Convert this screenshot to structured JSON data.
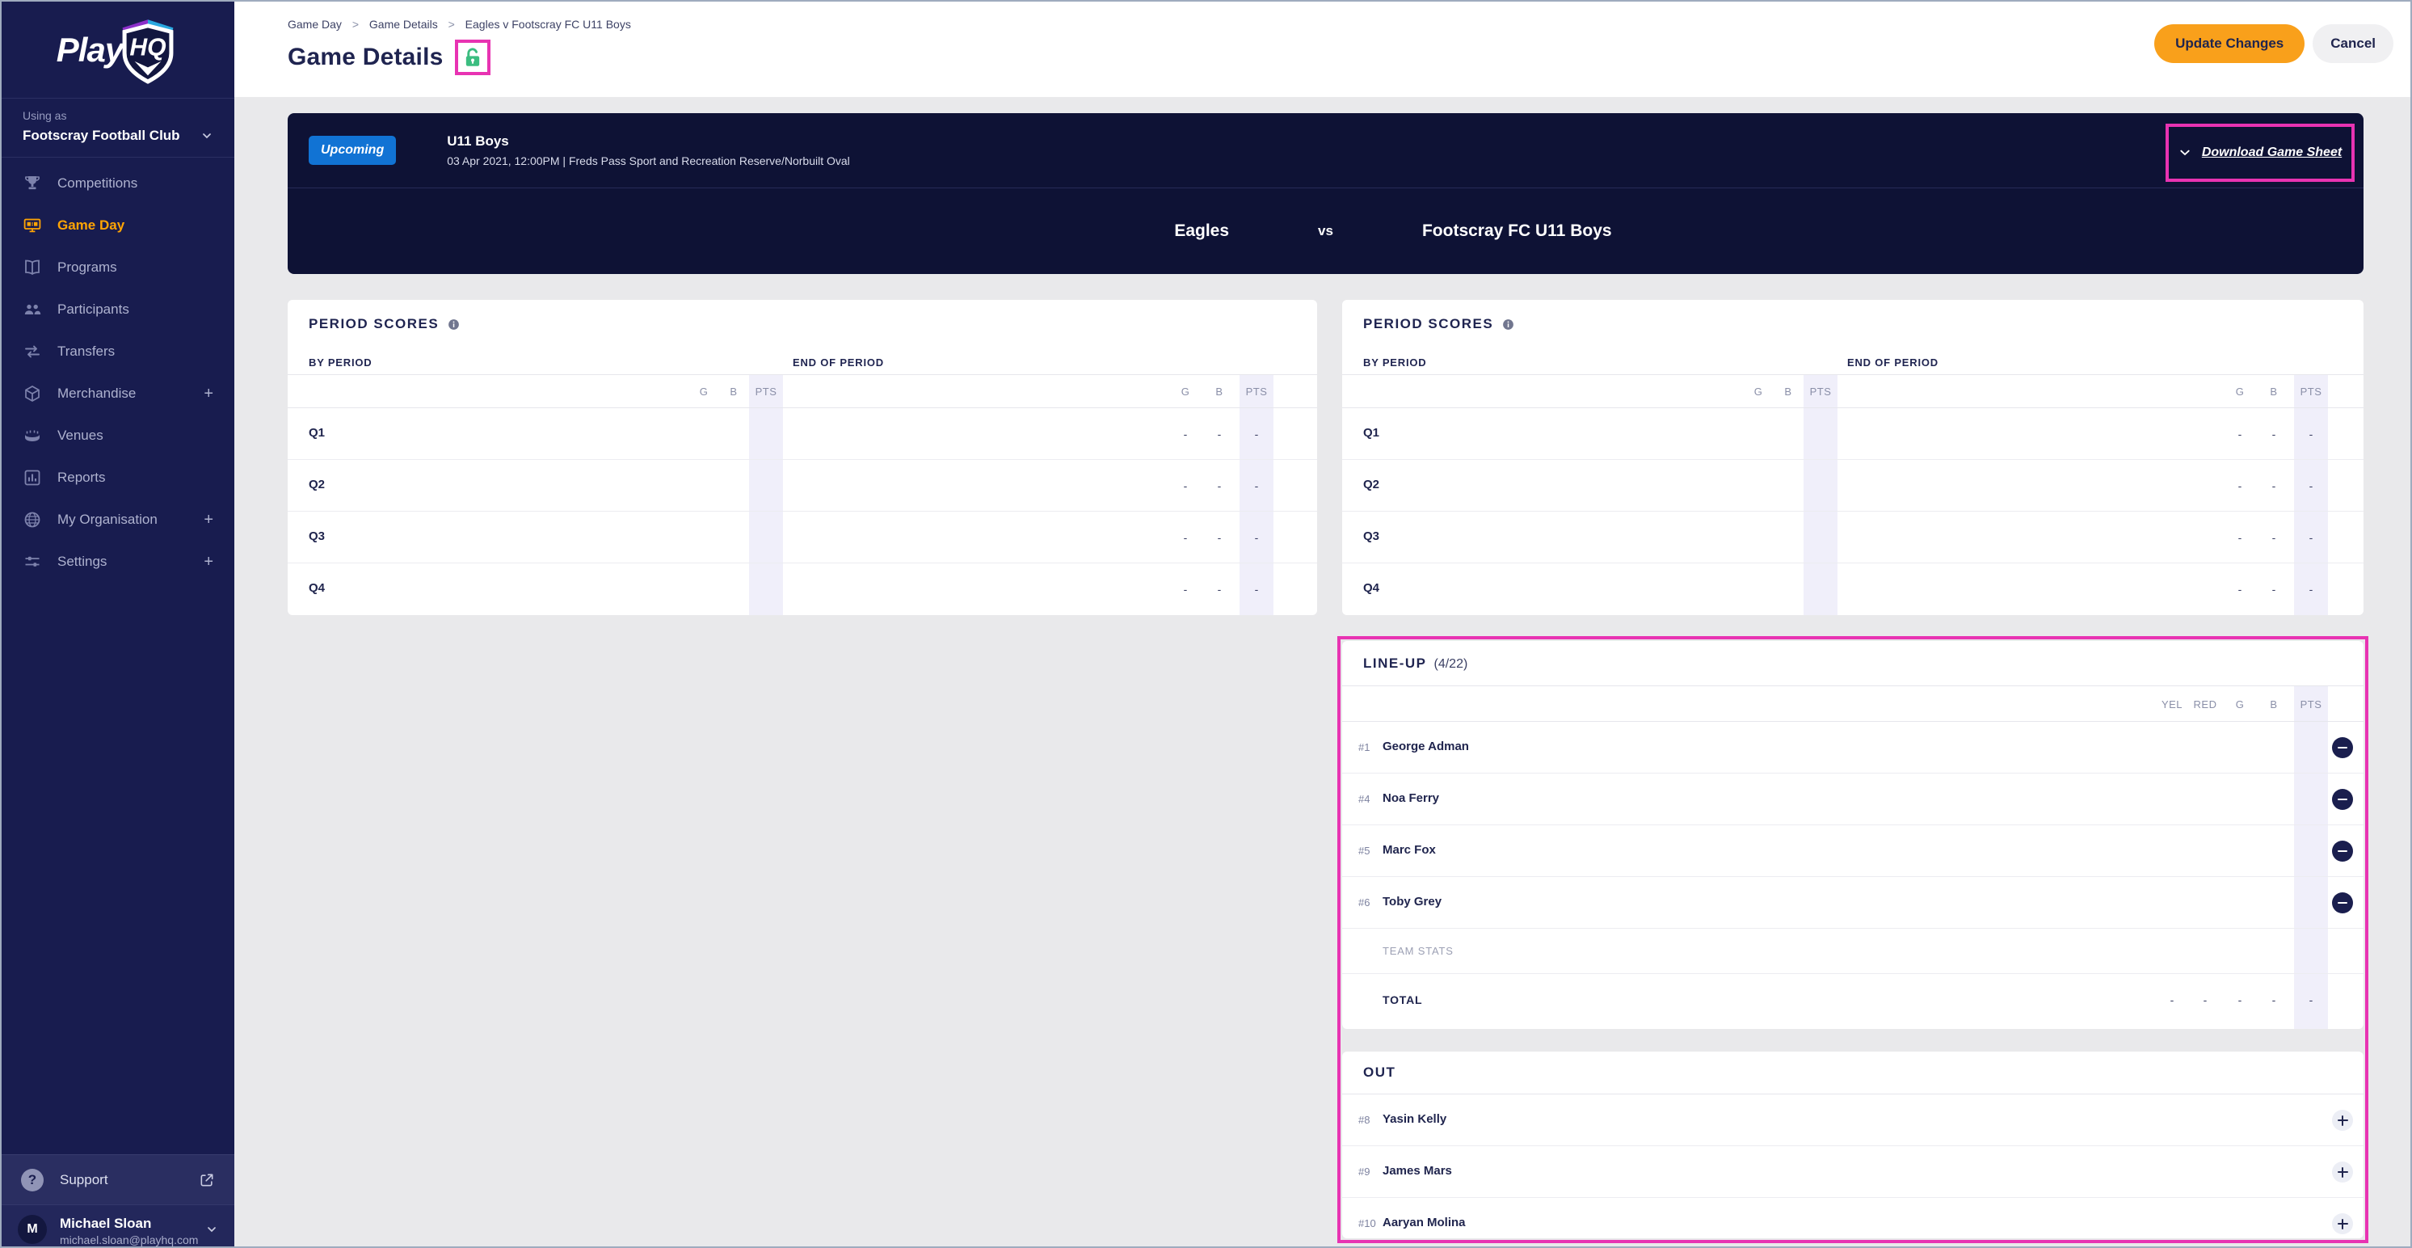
{
  "colors": {
    "magenta": "#E833B2",
    "green": "#3BBD80",
    "orange": "#F9A01B",
    "badge_blue": "#1173D4",
    "active_orange": "#FFA404",
    "sidebar_bg": "#181C4F",
    "banner_bg": "#0E1235",
    "lavender": "#F0EFFA"
  },
  "sidebar": {
    "logo_play": "Play",
    "logo_hq": "HQ",
    "using_as": "Using as",
    "org_name": "Footscray Football Club",
    "items": [
      {
        "label": "Competitions"
      },
      {
        "label": "Game Day"
      },
      {
        "label": "Programs"
      },
      {
        "label": "Participants"
      },
      {
        "label": "Transfers"
      },
      {
        "label": "Merchandise",
        "suffix": "+"
      },
      {
        "label": "Venues"
      },
      {
        "label": "Reports"
      },
      {
        "label": "My Organisation",
        "suffix": "+"
      },
      {
        "label": "Settings",
        "suffix": "+"
      }
    ],
    "support": "Support",
    "support_icon": "?",
    "user": {
      "initial": "M",
      "name": "Michael Sloan",
      "email": "michael.sloan@playhq.com"
    }
  },
  "header": {
    "breadcrumb": {
      "items": [
        "Game Day",
        "Game Details",
        "Eagles v Footscray FC U11 Boys"
      ],
      "separator": ">"
    },
    "title": "Game Details",
    "update_button": "Update Changes",
    "cancel_button": "Cancel"
  },
  "banner": {
    "status": "Upcoming",
    "grade": "U11 Boys",
    "details": "03 Apr 2021, 12:00PM | Freds Pass Sport and Recreation Reserve/Norbuilt Oval",
    "download": "Download Game Sheet",
    "home_team": "Eagles",
    "vs": "vs",
    "away_team": "Footscray FC U11 Boys"
  },
  "period_scores": {
    "title": "PERIOD SCORES",
    "by_period": "BY PERIOD",
    "end_of_period": "END OF PERIOD",
    "col_g": "G",
    "col_b": "B",
    "col_pts": "PTS",
    "rows": [
      {
        "label": "Q1",
        "g": "-",
        "b": "-",
        "pts": "-"
      },
      {
        "label": "Q2",
        "g": "-",
        "b": "-",
        "pts": "-"
      },
      {
        "label": "Q3",
        "g": "-",
        "b": "-",
        "pts": "-"
      },
      {
        "label": "Q4",
        "g": "-",
        "b": "-",
        "pts": "-"
      }
    ]
  },
  "lineup": {
    "title": "LINE-UP",
    "count": "(4/22)",
    "col_yel": "YEL",
    "col_red": "RED",
    "col_g": "G",
    "col_b": "B",
    "col_pts": "PTS",
    "players": [
      {
        "number": "#1",
        "name": "George Adman"
      },
      {
        "number": "#4",
        "name": "Noa Ferry"
      },
      {
        "number": "#5",
        "name": "Marc Fox"
      },
      {
        "number": "#6",
        "name": "Toby Grey"
      }
    ],
    "team_stats": "TEAM STATS",
    "total": "TOTAL",
    "totals": {
      "yel": "-",
      "red": "-",
      "g": "-",
      "b": "-",
      "pts": "-"
    }
  },
  "out": {
    "title": "OUT",
    "players": [
      {
        "number": "#8",
        "name": "Yasin Kelly"
      },
      {
        "number": "#9",
        "name": "James Mars"
      },
      {
        "number": "#10",
        "name": "Aaryan Molina"
      }
    ]
  }
}
